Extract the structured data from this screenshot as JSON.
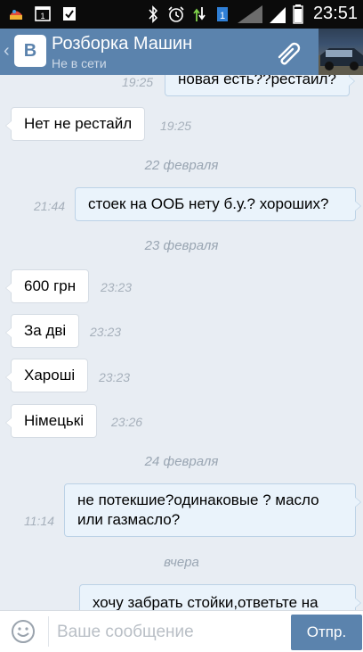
{
  "status_bar": {
    "time": "23:51",
    "icons": [
      "app-notification-icon",
      "calendar-icon",
      "clipboard-check-icon",
      "bluetooth-icon",
      "alarm-icon",
      "data-transfer-icon",
      "sim1-icon",
      "signal-icon",
      "battery-icon"
    ],
    "sim_label": "1",
    "calendar_label": "1"
  },
  "header": {
    "title": "Розборка Машин",
    "subtitle": "Не в сети",
    "logo_letter": "B",
    "accent_color": "#5b83ad"
  },
  "messages": [
    {
      "direction": "out",
      "text": "новая есть??рестайл?",
      "time": "19:25"
    },
    {
      "direction": "in",
      "text": "Нет не рестайл",
      "time": "19:25"
    },
    {
      "type": "date",
      "text": "22 февраля"
    },
    {
      "direction": "out",
      "text": "стоек на ООБ нету б.у.? хороших?",
      "time": "21:44"
    },
    {
      "type": "date",
      "text": "23 февраля"
    },
    {
      "direction": "in",
      "text": "600 грн",
      "time": "23:23"
    },
    {
      "direction": "in",
      "text": "За дві",
      "time": "23:23"
    },
    {
      "direction": "in",
      "text": "Хароші",
      "time": "23:23"
    },
    {
      "direction": "in",
      "text": "Німецькі",
      "time": "23:26"
    },
    {
      "type": "date",
      "text": "24 февраля"
    },
    {
      "direction": "out",
      "text": "не потекшие?одинаковые ? масло или газмасло?",
      "time": "11:14"
    },
    {
      "type": "date",
      "text": "вчера"
    },
    {
      "direction": "out",
      "text": "хочу забрать стойки,ответьте на",
      "time": ""
    }
  ],
  "composer": {
    "placeholder": "Ваше сообщение",
    "send_label": "Отпр."
  }
}
